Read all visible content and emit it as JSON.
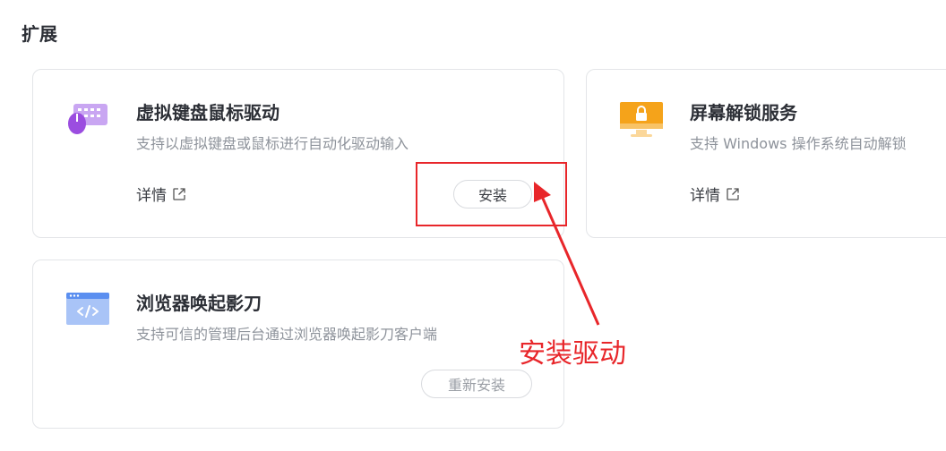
{
  "section": {
    "title": "扩展"
  },
  "cards": [
    {
      "title": "虚拟键盘鼠标驱动",
      "description": "支持以虚拟键盘或鼠标进行自动化驱动输入",
      "detail_label": "详情",
      "icon": "keyboard-mouse-icon",
      "action_label": "安装"
    },
    {
      "title": "屏幕解锁服务",
      "description": "支持 Windows 操作系统自动解锁",
      "detail_label": "详情",
      "icon": "screen-lock-icon"
    },
    {
      "title": "浏览器唤起影刀",
      "description": "支持可信的管理后台通过浏览器唤起影刀客户端",
      "icon": "browser-code-icon",
      "action_label": "重新安装"
    }
  ],
  "annotation": {
    "text": "安装驱动",
    "color": "#e8262a"
  },
  "colors": {
    "keyboard_icon": "#9b4de0",
    "lock_icon": "#f5a31a",
    "browser_icon": "#5b8ff0"
  }
}
